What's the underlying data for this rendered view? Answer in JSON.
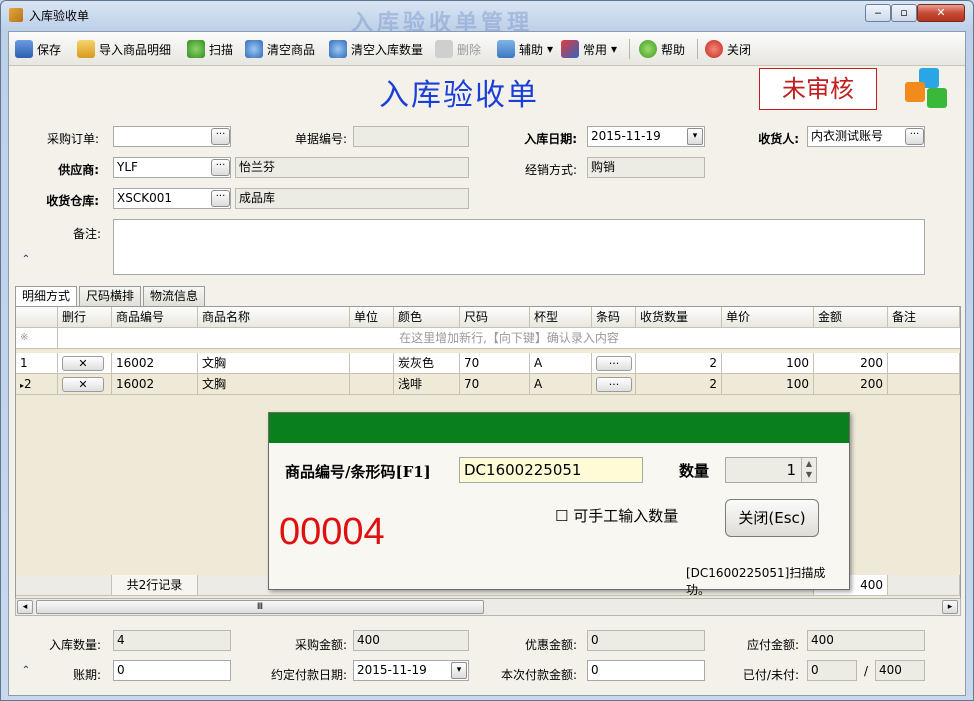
{
  "window": {
    "title": "入库验收单",
    "ghost_title": "入库验收单管理",
    "min": "‒",
    "max": "▫",
    "close": "✕"
  },
  "toolbar": {
    "save": "保存",
    "import": "导入商品明细",
    "scan": "扫描",
    "clear_goods": "清空商品",
    "clear_qty": "清空入库数量",
    "delete": "删除",
    "assist": "辅助",
    "common": "常用",
    "help": "帮助",
    "close": "关闭"
  },
  "header": {
    "doc_title": "入库验收单",
    "status": "未审核"
  },
  "form": {
    "po_label": "采购订单:",
    "po_value": "",
    "docno_label": "单据编号:",
    "docno_value": "",
    "indate_label": "入库日期:",
    "indate_value": "2015-11-19",
    "receiver_label": "收货人:",
    "receiver_value": "内衣测试账号",
    "supplier_label": "供应商:",
    "supplier_code": "YLF",
    "supplier_name": "怡兰芬",
    "mode_label": "经销方式:",
    "mode_value": "购销",
    "warehouse_label": "收货仓库:",
    "warehouse_code": "XSCK001",
    "warehouse_name": "成品库",
    "remark_label": "备注:",
    "remark_value": ""
  },
  "tabs": [
    "明细方式",
    "尺码横排",
    "物流信息"
  ],
  "grid": {
    "columns": [
      "",
      "删行",
      "商品编号",
      "商品名称",
      "单位",
      "颜色",
      "尺码",
      "杯型",
      "条码",
      "收货数量",
      "单价",
      "金额",
      "备注"
    ],
    "new_row_hint": "在这里增加新行,【向下键】确认录入内容",
    "new_row_marker": "※",
    "delete_btn": "✕",
    "barcode_btn": "···",
    "rows": [
      {
        "no": "1",
        "code": "16002",
        "name": "文胸",
        "unit": "",
        "color": "炭灰色",
        "size": "70",
        "cup": "A",
        "qty": "2",
        "price": "100",
        "amount": "200",
        "remark": ""
      },
      {
        "no": "2",
        "code": "16002",
        "name": "文胸",
        "unit": "",
        "color": "浅啡",
        "size": "70",
        "cup": "A",
        "qty": "2",
        "price": "100",
        "amount": "200",
        "remark": ""
      }
    ],
    "footer_count": "共2行记录",
    "footer_amount": "400",
    "scroll_grip": "Ⅲ"
  },
  "dialog": {
    "code_label": "商品编号/条形码[F1]",
    "code_value": "DC1600225051",
    "qty_label": "数量",
    "qty_value": "1",
    "counter": "00004",
    "manual_qty": "可手工输入数量",
    "close_btn": "关闭(Esc)",
    "message": "[DC1600225051]扫描成功。"
  },
  "summary": {
    "in_qty_label": "入库数量:",
    "in_qty": "4",
    "po_amount_label": "采购金额:",
    "po_amount": "400",
    "discount_label": "优惠金额:",
    "discount": "0",
    "payable_label": "应付金额:",
    "payable": "400",
    "term_label": "账期:",
    "term": "0",
    "pay_date_label": "约定付款日期:",
    "pay_date": "2015-11-19",
    "this_pay_label": "本次付款金额:",
    "this_pay": "0",
    "paid_label": "已付/未付:",
    "paid": "0",
    "sep": "/",
    "unpaid": "400"
  },
  "colors": {
    "accent": "#1a3fd8",
    "status": "#c01f1f",
    "dialog_head": "#0a7f1e",
    "counter": "#e01010"
  }
}
